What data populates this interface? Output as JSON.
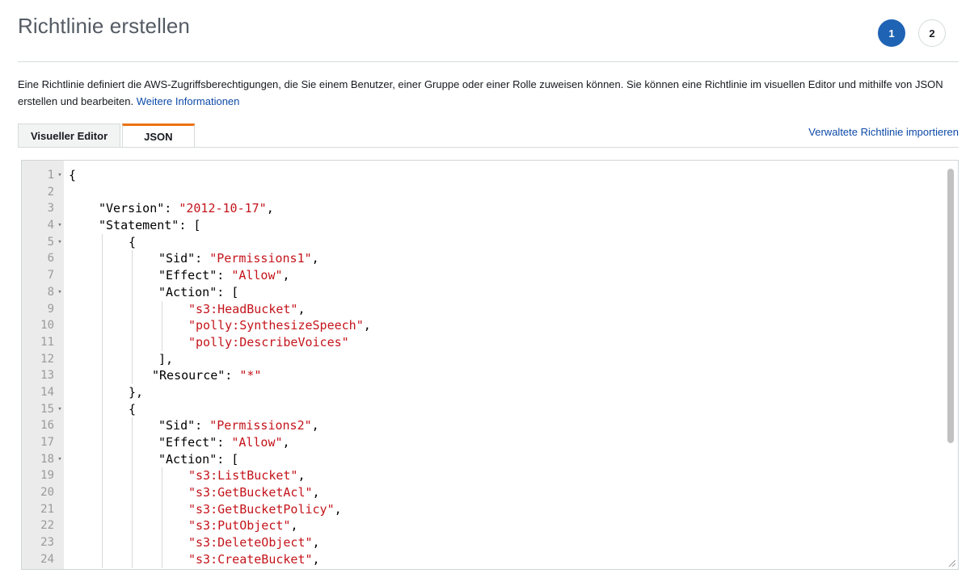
{
  "page": {
    "title": "Richtlinie erstellen",
    "steps": [
      "1",
      "2"
    ],
    "description": "Eine Richtlinie definiert die AWS-Zugriffsberechtigungen, die Sie einem Benutzer, einer Gruppe oder einer Rolle zuweisen können. Sie können eine Richtlinie im visuellen Editor und mithilfe von JSON erstellen und bearbeiten.",
    "learn_more": "Weitere Informationen"
  },
  "tabs": {
    "visual": "Visueller Editor",
    "json": "JSON",
    "import_link": "Verwaltete Richtlinie importieren"
  },
  "colors": {
    "accent": "#1f63b4",
    "tab_active_border": "#ec7211",
    "link": "#0d4aa8",
    "string": "#c4141b"
  },
  "editor": {
    "lines": [
      {
        "n": "1",
        "fold": true,
        "indent": 0,
        "code": "{",
        "str": ""
      },
      {
        "n": "2",
        "fold": false,
        "indent": 0,
        "code": "",
        "str": ""
      },
      {
        "n": "3",
        "fold": false,
        "indent": 1,
        "code": "\"Version\": ",
        "str": "\"2012-10-17\"",
        "post": ","
      },
      {
        "n": "4",
        "fold": true,
        "indent": 1,
        "code": "\"Statement\": [",
        "str": ""
      },
      {
        "n": "5",
        "fold": true,
        "indent": 2,
        "code": "{",
        "str": ""
      },
      {
        "n": "6",
        "fold": false,
        "indent": 3,
        "code": "\"Sid\": ",
        "str": "\"Permissions1\"",
        "post": ","
      },
      {
        "n": "7",
        "fold": false,
        "indent": 3,
        "code": "\"Effect\": ",
        "str": "\"Allow\"",
        "post": ","
      },
      {
        "n": "8",
        "fold": true,
        "indent": 3,
        "code": "\"Action\": [",
        "str": ""
      },
      {
        "n": "9",
        "fold": false,
        "indent": 4,
        "code": "",
        "str": "\"s3:HeadBucket\"",
        "post": ","
      },
      {
        "n": "10",
        "fold": false,
        "indent": 4,
        "code": "",
        "str": "\"polly:SynthesizeSpeech\"",
        "post": ","
      },
      {
        "n": "11",
        "fold": false,
        "indent": 4,
        "code": "",
        "str": "\"polly:DescribeVoices\"",
        "post": ""
      },
      {
        "n": "12",
        "fold": false,
        "indent": 3,
        "code": "],",
        "str": ""
      },
      {
        "n": "13",
        "fold": false,
        "indent": 3,
        "nudge": true,
        "code": "\"Resource\": ",
        "str": "\"*\"",
        "post": ""
      },
      {
        "n": "14",
        "fold": false,
        "indent": 2,
        "code": "},",
        "str": ""
      },
      {
        "n": "15",
        "fold": true,
        "indent": 2,
        "code": "{",
        "str": ""
      },
      {
        "n": "16",
        "fold": false,
        "indent": 3,
        "code": "\"Sid\": ",
        "str": "\"Permissions2\"",
        "post": ","
      },
      {
        "n": "17",
        "fold": false,
        "indent": 3,
        "code": "\"Effect\": ",
        "str": "\"Allow\"",
        "post": ","
      },
      {
        "n": "18",
        "fold": true,
        "indent": 3,
        "code": "\"Action\": [",
        "str": ""
      },
      {
        "n": "19",
        "fold": false,
        "indent": 4,
        "code": "",
        "str": "\"s3:ListBucket\"",
        "post": ","
      },
      {
        "n": "20",
        "fold": false,
        "indent": 4,
        "code": "",
        "str": "\"s3:GetBucketAcl\"",
        "post": ","
      },
      {
        "n": "21",
        "fold": false,
        "indent": 4,
        "code": "",
        "str": "\"s3:GetBucketPolicy\"",
        "post": ","
      },
      {
        "n": "22",
        "fold": false,
        "indent": 4,
        "code": "",
        "str": "\"s3:PutObject\"",
        "post": ","
      },
      {
        "n": "23",
        "fold": false,
        "indent": 4,
        "code": "",
        "str": "\"s3:DeleteObject\"",
        "post": ","
      },
      {
        "n": "24",
        "fold": false,
        "indent": 4,
        "code": "",
        "str": "\"s3:CreateBucket\"",
        "post": ","
      }
    ]
  }
}
